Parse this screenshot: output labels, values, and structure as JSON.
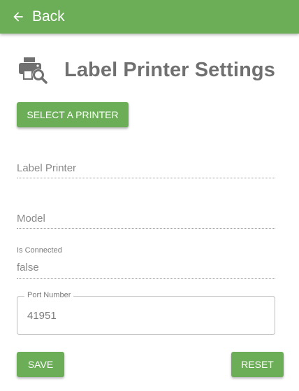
{
  "topbar": {
    "back_label": "Back",
    "color": "#6cad58",
    "back_icon": "arrow-left-icon"
  },
  "header": {
    "icon": "printer-search-icon",
    "title": "Label Printer Settings"
  },
  "select_printer_button": "SELECT A PRINTER",
  "fields": {
    "label_printer": {
      "placeholder": "Label Printer",
      "value": ""
    },
    "model": {
      "placeholder": "Model",
      "value": ""
    },
    "is_connected": {
      "label": "Is Connected",
      "value": "false"
    },
    "port_number": {
      "label": "Port Number",
      "value": "41951"
    }
  },
  "actions": {
    "save": "SAVE",
    "reset": "RESET"
  }
}
